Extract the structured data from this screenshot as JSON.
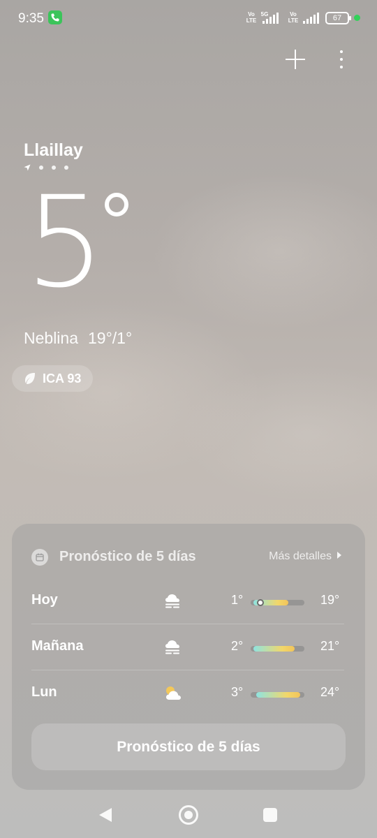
{
  "status_bar": {
    "time": "9:35",
    "sim1_label": "Vo\nLTE",
    "sim1_network": "5G",
    "sim2_label": "Vo\nLTE",
    "battery": "67"
  },
  "location": {
    "city": "Llaillay",
    "page_count": 4,
    "current_page": 1
  },
  "current": {
    "temperature": "5",
    "condition": "Neblina",
    "high_low": "19°/1°",
    "aqi_label": "ICA 93"
  },
  "forecast": {
    "title": "Pronóstico de 5 días",
    "more_details": "Más detalles",
    "days": [
      {
        "day": "Hoy",
        "icon": "fog-icon",
        "low": "1°",
        "high": "19°",
        "bar_start": 0.05,
        "bar_end": 0.7,
        "current_marker": 0.18
      },
      {
        "day": "Mañana",
        "icon": "fog-icon",
        "low": "2°",
        "high": "21°",
        "bar_start": 0.05,
        "bar_end": 0.82
      },
      {
        "day": "Lun",
        "icon": "partly-cloudy-icon",
        "low": "3°",
        "high": "24°",
        "bar_start": 0.1,
        "bar_end": 0.92
      }
    ],
    "button_label": "Pronóstico de 5 días"
  },
  "colors": {
    "bar_start": "#8fe3e0",
    "bar_end": "#f2c45a",
    "status_green": "#33d15a"
  }
}
